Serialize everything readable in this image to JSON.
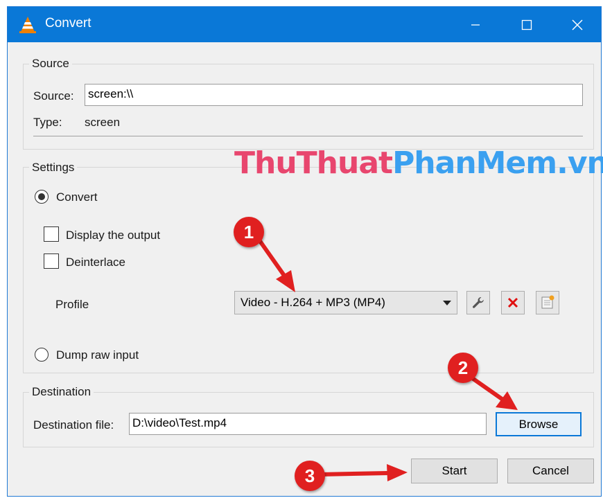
{
  "window": {
    "title": "Convert",
    "controls": {
      "minimize_icon": "minimize-icon",
      "maximize_icon": "maximize-icon",
      "close_icon": "close-icon"
    }
  },
  "source": {
    "legend": "Source",
    "source_label": "Source:",
    "source_value": "screen:\\\\",
    "type_label": "Type:",
    "type_value": "screen"
  },
  "settings": {
    "legend": "Settings",
    "convert_label": "Convert",
    "convert_selected": true,
    "display_output_label": "Display the output",
    "display_output_checked": false,
    "deinterlace_label": "Deinterlace",
    "deinterlace_checked": false,
    "profile_label": "Profile",
    "profile_value": "Video - H.264 + MP3 (MP4)",
    "profile_buttons": [
      "wrench-icon",
      "delete-x-icon",
      "new-profile-icon"
    ],
    "dump_raw_label": "Dump raw input",
    "dump_raw_selected": false
  },
  "destination": {
    "legend": "Destination",
    "file_label": "Destination file:",
    "file_value": "D:\\video\\Test.mp4",
    "browse_label": "Browse"
  },
  "actions": {
    "start_label": "Start",
    "cancel_label": "Cancel"
  },
  "watermark": {
    "part1": "ThuThuat",
    "part2": "PhanMem.vn"
  },
  "annotations": {
    "step1": "1",
    "step2": "2",
    "step3": "3",
    "color": "#e02020"
  },
  "colors": {
    "titlebar": "#0a78d7",
    "accent": "#0a78d7",
    "badge": "#e02020"
  }
}
